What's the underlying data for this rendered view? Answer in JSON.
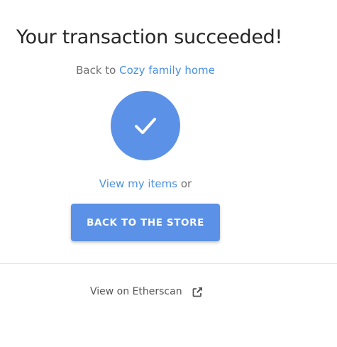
{
  "page": {
    "title": "Your transaction succeeded!",
    "back_prefix": "Back to ",
    "back_link": "Cozy family home",
    "items_link": "View my items",
    "items_suffix": " or",
    "store_button": "BACK TO THE STORE",
    "etherscan_label": "View on Etherscan"
  },
  "icons": {
    "success": "checkmark-icon",
    "external": "external-link-icon"
  },
  "colors": {
    "accent": "#5b91e6",
    "link": "#4a90e2",
    "divider": "#e4e4e4"
  }
}
